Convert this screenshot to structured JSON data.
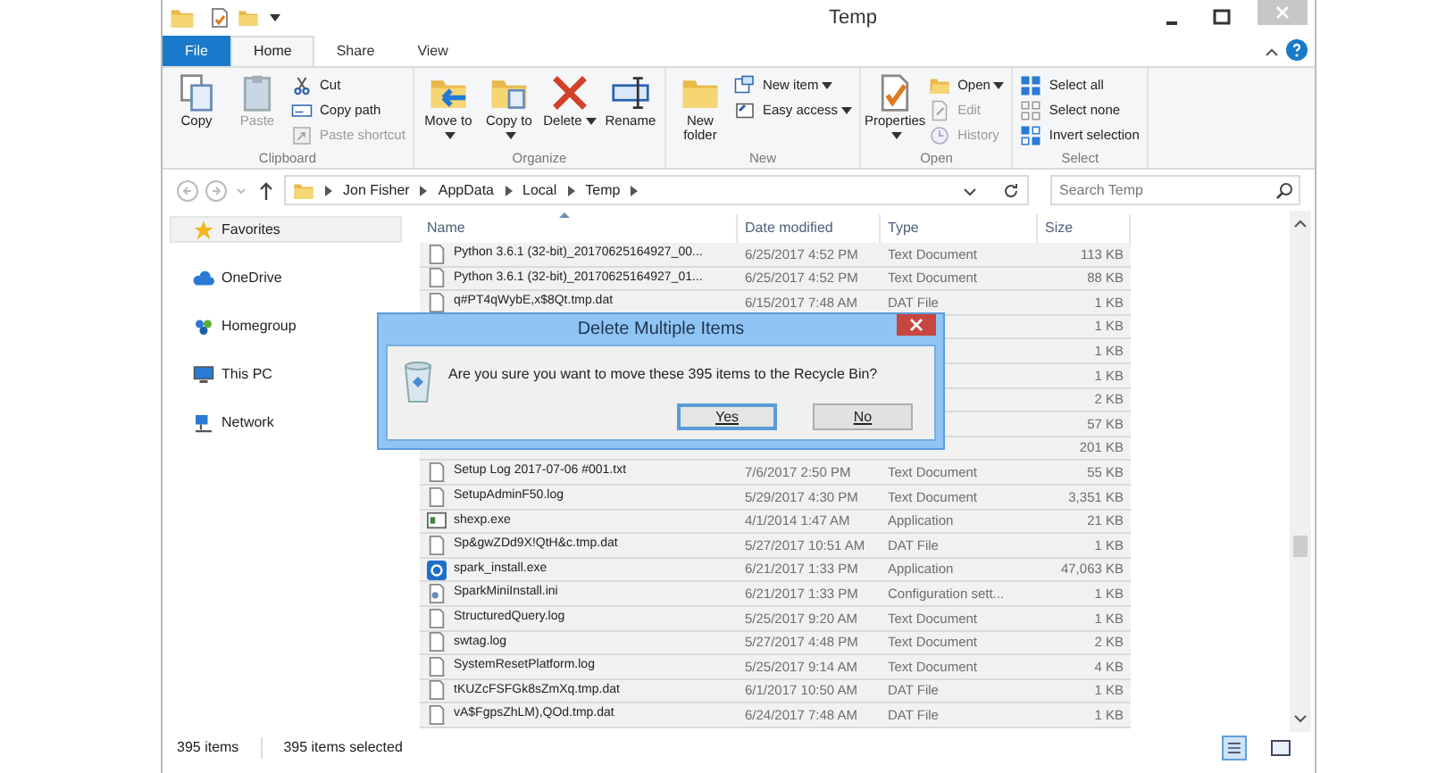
{
  "window": {
    "title": "Temp"
  },
  "tabs": [
    {
      "label": "File",
      "kind": "file",
      "selected": false
    },
    {
      "label": "Home",
      "kind": "tab",
      "selected": true
    },
    {
      "label": "Share",
      "kind": "tab",
      "selected": false
    },
    {
      "label": "View",
      "kind": "tab",
      "selected": false
    }
  ],
  "ribbon": [
    {
      "label": "Clipboard",
      "items": [
        {
          "kind": "large",
          "label": "Copy",
          "disabled": false
        },
        {
          "kind": "large",
          "label": "Paste",
          "disabled": true
        },
        {
          "kind": "small",
          "label": "Cut",
          "disabled": false
        },
        {
          "kind": "small",
          "label": "Copy path",
          "disabled": false
        },
        {
          "kind": "small",
          "label": "Paste shortcut",
          "disabled": true
        }
      ]
    },
    {
      "label": "Organize",
      "items": [
        {
          "kind": "large",
          "label": "Move to",
          "has_menu": true,
          "disabled": false
        },
        {
          "kind": "large",
          "label": "Copy to",
          "has_menu": true,
          "disabled": false
        },
        {
          "kind": "large",
          "label": "Delete",
          "has_menu": true,
          "disabled": false
        },
        {
          "kind": "large",
          "label": "Rename",
          "disabled": false
        }
      ]
    },
    {
      "label": "New",
      "items": [
        {
          "kind": "large",
          "label": "New folder",
          "disabled": false
        },
        {
          "kind": "small",
          "label": "New item",
          "has_menu": true,
          "disabled": false
        },
        {
          "kind": "small",
          "label": "Easy access",
          "has_menu": true,
          "disabled": false
        }
      ]
    },
    {
      "label": "Open",
      "items": [
        {
          "kind": "large",
          "label": "Properties",
          "has_menu": true,
          "disabled": false
        },
        {
          "kind": "small",
          "label": "Open",
          "has_menu": true,
          "disabled": false
        },
        {
          "kind": "small",
          "label": "Edit",
          "disabled": true
        },
        {
          "kind": "small",
          "label": "History",
          "disabled": true
        }
      ]
    },
    {
      "label": "Select",
      "items": [
        {
          "kind": "small",
          "label": "Select all",
          "disabled": false
        },
        {
          "kind": "small",
          "label": "Select none",
          "disabled": false
        },
        {
          "kind": "small",
          "label": "Invert selection",
          "disabled": false
        }
      ]
    }
  ],
  "address": {
    "crumbs": [
      "Jon Fisher",
      "AppData",
      "Local",
      "Temp"
    ],
    "search_placeholder": "Search Temp"
  },
  "sidebar": {
    "items": [
      {
        "label": "Favorites",
        "selected": true
      },
      {
        "label": "OneDrive",
        "selected": false
      },
      {
        "label": "Homegroup",
        "selected": false
      },
      {
        "label": "This PC",
        "selected": false
      },
      {
        "label": "Network",
        "selected": false
      }
    ]
  },
  "table": {
    "columns": [
      "Name",
      "Date modified",
      "Type",
      "Size"
    ],
    "rows": [
      {
        "name": "Python 3.6.1 (32-bit)_20170625164927_00...",
        "date": "6/25/2017 4:52 PM",
        "type": "Text Document",
        "size": "113 KB",
        "kind": "doc",
        "selected": true
      },
      {
        "name": "Python 3.6.1 (32-bit)_20170625164927_01...",
        "date": "6/25/2017 4:52 PM",
        "type": "Text Document",
        "size": "88 KB",
        "kind": "doc",
        "selected": true
      },
      {
        "name": "q#PT4qWybE,x$8Qt.tmp.dat",
        "date": "6/15/2017 7:48 AM",
        "type": "DAT File",
        "size": "1 KB",
        "kind": "doc",
        "selected": true
      },
      {
        "size": "1 KB",
        "selected": true
      },
      {
        "size": "1 KB",
        "selected": true
      },
      {
        "size": "1 KB",
        "selected": true
      },
      {
        "size": "2 KB",
        "selected": true
      },
      {
        "size": "57 KB",
        "selected": true
      },
      {
        "size": "201 KB",
        "selected": true
      },
      {
        "name": "Setup Log 2017-07-06 #001.txt",
        "date": "7/6/2017 2:50 PM",
        "type": "Text Document",
        "size": "55 KB",
        "kind": "doc",
        "selected": true
      },
      {
        "name": "SetupAdminF50.log",
        "date": "5/29/2017 4:30 PM",
        "type": "Text Document",
        "size": "3,351 KB",
        "kind": "doc",
        "selected": true
      },
      {
        "name": "shexp.exe",
        "date": "4/1/2014 1:47 AM",
        "type": "Application",
        "size": "21 KB",
        "kind": "app",
        "selected": true
      },
      {
        "name": "Sp&gwZDd9X!QtH&c.tmp.dat",
        "date": "5/27/2017 10:51 AM",
        "type": "DAT File",
        "size": "1 KB",
        "kind": "doc",
        "selected": true
      },
      {
        "name": "spark_install.exe",
        "date": "6/21/2017 1:33 PM",
        "type": "Application",
        "size": "47,063 KB",
        "kind": "logo",
        "selected": true
      },
      {
        "name": "SparkMiniInstall.ini",
        "date": "6/21/2017 1:33 PM",
        "type": "Configuration sett...",
        "size": "1 KB",
        "kind": "ini",
        "selected": true
      },
      {
        "name": "StructuredQuery.log",
        "date": "5/25/2017 9:20 AM",
        "type": "Text Document",
        "size": "1 KB",
        "kind": "doc",
        "selected": true
      },
      {
        "name": "swtag.log",
        "date": "5/27/2017 4:48 PM",
        "type": "Text Document",
        "size": "2 KB",
        "kind": "doc",
        "selected": true
      },
      {
        "name": "SystemResetPlatform.log",
        "date": "5/25/2017 9:14 AM",
        "type": "Text Document",
        "size": "4 KB",
        "kind": "doc",
        "selected": true
      },
      {
        "name": "tKUZcFSFGk8sZmXq.tmp.dat",
        "date": "6/1/2017 10:50 AM",
        "type": "DAT File",
        "size": "1 KB",
        "kind": "doc",
        "selected": true
      },
      {
        "name": "vA$FgpsZhLM),QOd.tmp.dat",
        "date": "6/24/2017 7:48 AM",
        "type": "DAT File",
        "size": "1 KB",
        "kind": "doc",
        "selected": true
      }
    ]
  },
  "dialog": {
    "title": "Delete Multiple Items",
    "message": "Are you sure you want to move these 395 items to the Recycle Bin?",
    "buttons": [
      {
        "label": "Yes",
        "selected": true
      },
      {
        "label": "No",
        "selected": false
      }
    ]
  },
  "status_bar": {
    "count": "395 items",
    "selection": "395 items selected"
  }
}
